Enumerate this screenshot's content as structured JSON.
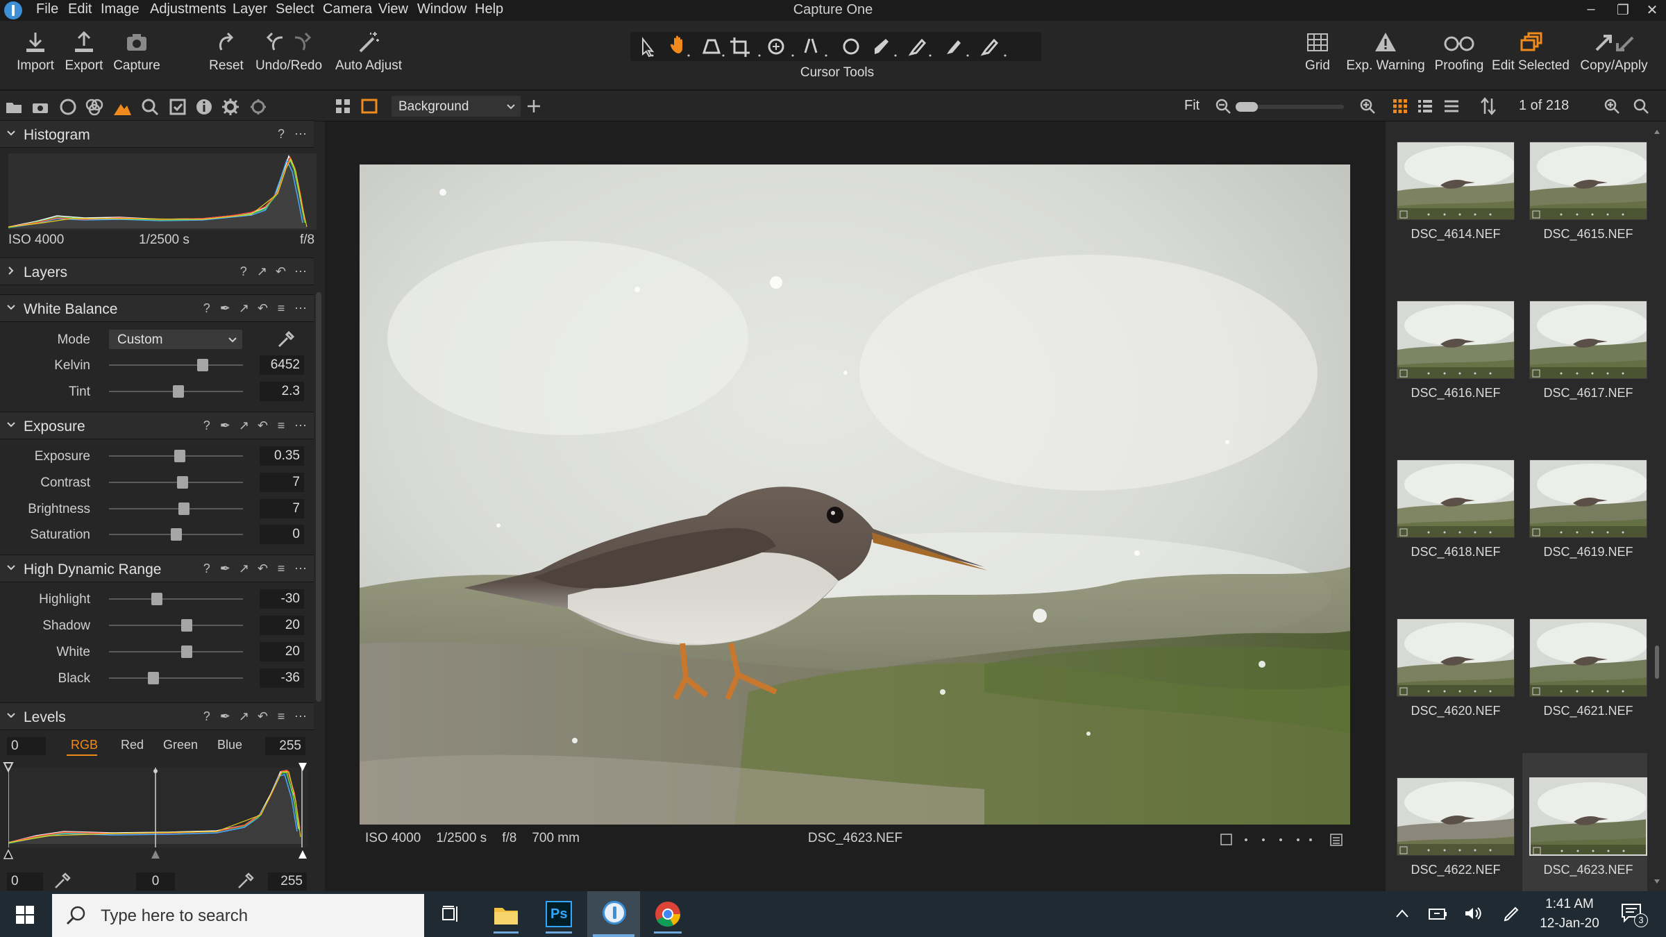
{
  "app": {
    "title": "Capture One"
  },
  "menu": [
    "File",
    "Edit",
    "Image",
    "Adjustments",
    "Layer",
    "Select",
    "Camera",
    "View",
    "Window",
    "Help"
  ],
  "toolbar": {
    "left": [
      {
        "label": "Import",
        "icon": "import-icon"
      },
      {
        "label": "Export",
        "icon": "export-icon"
      },
      {
        "label": "Capture",
        "icon": "camera-icon"
      },
      {
        "label": "Reset",
        "icon": "reset-icon"
      },
      {
        "label": "Undo/Redo",
        "icon": "undo-icon"
      },
      {
        "label": "Auto Adjust",
        "icon": "wand-icon"
      }
    ],
    "cursor_tools_label": "Cursor Tools",
    "right": [
      {
        "label": "Grid",
        "icon": "grid-icon"
      },
      {
        "label": "Exp. Warning",
        "icon": "warning-icon"
      },
      {
        "label": "Proofing",
        "icon": "glasses-icon"
      },
      {
        "label": "Edit Selected",
        "icon": "edit-selected-icon"
      },
      {
        "label": "Copy/Apply",
        "icon": "copy-apply-icon"
      }
    ]
  },
  "histogram": {
    "title": "Histogram",
    "iso": "ISO 4000",
    "shutter": "1/2500 s",
    "aperture": "f/8"
  },
  "layers": {
    "title": "Layers"
  },
  "white_balance": {
    "title": "White Balance",
    "mode_label": "Mode",
    "mode_value": "Custom",
    "params": [
      {
        "label": "Kelvin",
        "value": "6452",
        "pos": 0.7
      },
      {
        "label": "Tint",
        "value": "2.3",
        "pos": 0.52
      }
    ]
  },
  "exposure": {
    "title": "Exposure",
    "params": [
      {
        "label": "Exposure",
        "value": "0.35",
        "pos": 0.53
      },
      {
        "label": "Contrast",
        "value": "7",
        "pos": 0.55
      },
      {
        "label": "Brightness",
        "value": "7",
        "pos": 0.56
      },
      {
        "label": "Saturation",
        "value": "0",
        "pos": 0.5
      }
    ]
  },
  "hdr": {
    "title": "High Dynamic Range",
    "params": [
      {
        "label": "Highlight",
        "value": "-30",
        "pos": 0.36
      },
      {
        "label": "Shadow",
        "value": "20",
        "pos": 0.58
      },
      {
        "label": "White",
        "value": "20",
        "pos": 0.58
      },
      {
        "label": "Black",
        "value": "-36",
        "pos": 0.33
      }
    ]
  },
  "levels": {
    "title": "Levels",
    "channels": [
      "RGB",
      "Red",
      "Green",
      "Blue"
    ],
    "active_channel": "RGB",
    "input_low": "0",
    "input_high": "255",
    "output_low": "0",
    "midpoint": "0",
    "output_high": "255"
  },
  "viewer": {
    "layer_select": "Background",
    "zoom": "Fit",
    "count": "1 of 218",
    "caption": {
      "iso": "ISO 4000",
      "shutter": "1/2500 s",
      "aperture": "f/8",
      "focal": "700 mm",
      "file": "DSC_4623.NEF"
    }
  },
  "browser": {
    "thumbs": [
      {
        "name": "DSC_4614.NEF"
      },
      {
        "name": "DSC_4615.NEF"
      },
      {
        "name": "DSC_4616.NEF"
      },
      {
        "name": "DSC_4617.NEF"
      },
      {
        "name": "DSC_4618.NEF"
      },
      {
        "name": "DSC_4619.NEF"
      },
      {
        "name": "DSC_4620.NEF"
      },
      {
        "name": "DSC_4621.NEF"
      },
      {
        "name": "DSC_4622.NEF"
      },
      {
        "name": "DSC_4623.NEF",
        "selected": true
      }
    ]
  },
  "taskbar": {
    "search_placeholder": "Type here to search",
    "time": "1:41 AM",
    "date": "12-Jan-20",
    "notifications": "3",
    "apps": [
      "task-view-icon",
      "file-explorer-icon",
      "photoshop-icon",
      "capture-one-icon",
      "chrome-icon"
    ],
    "photoshop_label": "Ps"
  },
  "colors": {
    "accent": "#f08a1c",
    "panel": "#262626",
    "viewer": "#1e1e1e",
    "taskbar": "#1f2a33"
  }
}
